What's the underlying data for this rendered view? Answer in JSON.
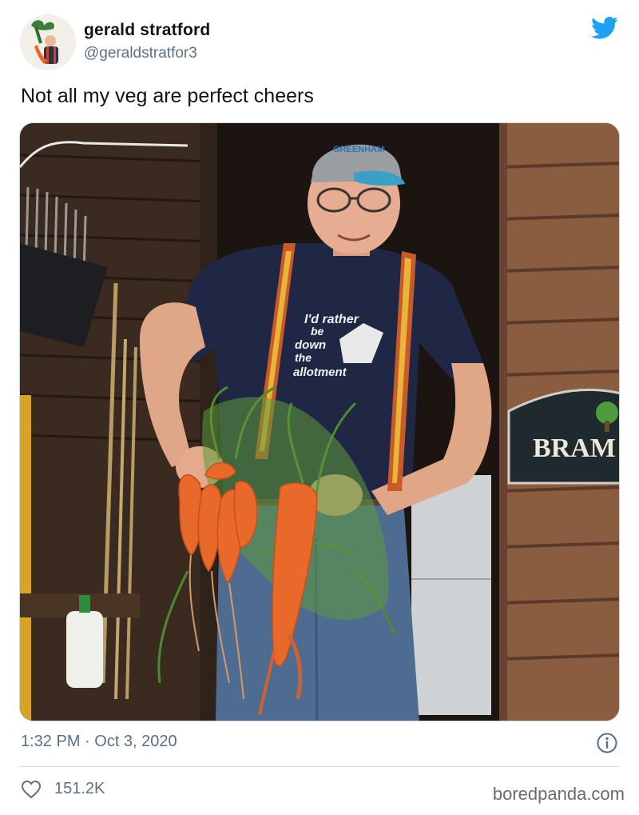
{
  "tweet": {
    "author_name": "gerald stratford",
    "author_handle": "@geraldstratfor3",
    "text": "Not all my veg are perfect cheers",
    "timestamp": "1:32 PM · Oct 3, 2020",
    "likes": "151.2K"
  },
  "photo": {
    "tshirt_text": [
      "I'd rather",
      "be",
      "down",
      "the",
      "allotment"
    ],
    "sign_text": "BRAM",
    "cap_text": "GREENHAM"
  },
  "watermark": "boredpanda.com",
  "icons": {
    "brand": "twitter-bird-icon",
    "info": "info-icon",
    "like": "heart-icon"
  },
  "colors": {
    "twitter_blue": "#1da1f2",
    "secondary_text": "#5b7083",
    "carrot": "#e8692a"
  }
}
